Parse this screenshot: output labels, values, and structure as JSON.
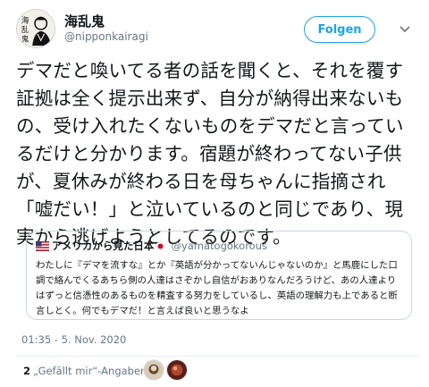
{
  "user": {
    "display_name": "海乱鬼",
    "handle": "@nipponkairagi",
    "avatar_icon": "ink-portrait-avatar"
  },
  "actions": {
    "follow_label": "Folgen",
    "caret_icon": "chevron-down-icon"
  },
  "tweet": {
    "text": "デマだと喚いてる者の話を聞くと、それを覆す証拠は全く提示出来ず、自分が納得出来ないもの、受け入れたくないものをデマだと言っているだけと分かります。宿題が終わってない子供が、夏休みが終わる日を母ちゃんに指摘され「嘘だい！」と泣いているのと同じであり、現実から逃げようとしてるのです。",
    "timestamp": "01:35 - 5. Nov. 2020"
  },
  "quote": {
    "display_name": "アメリカから見た日本",
    "handle": "@yamatogokorous",
    "flag_icons": [
      "us-flag-icon",
      "japan-flag-icon"
    ],
    "text": "わたしに『デマを流すな』とか『英語が分かってないんじゃないのか』と馬鹿にした口調で絡んでくるあちら側の人達はさぞかし自信がおありなんだろうけど、あの人達よりはずっと信憑性のあるものを精査する努力をしているし、英語の理解力も上であると断言しとく。何でもデマだ！と言えば良いと思うなよ"
  },
  "engagement": {
    "likes_count": "2",
    "likes_label": "„Gefällt mir“-Angaben"
  },
  "colors": {
    "accent": "#1da1f2",
    "muted": "#657786",
    "border": "#ccd6dd"
  }
}
